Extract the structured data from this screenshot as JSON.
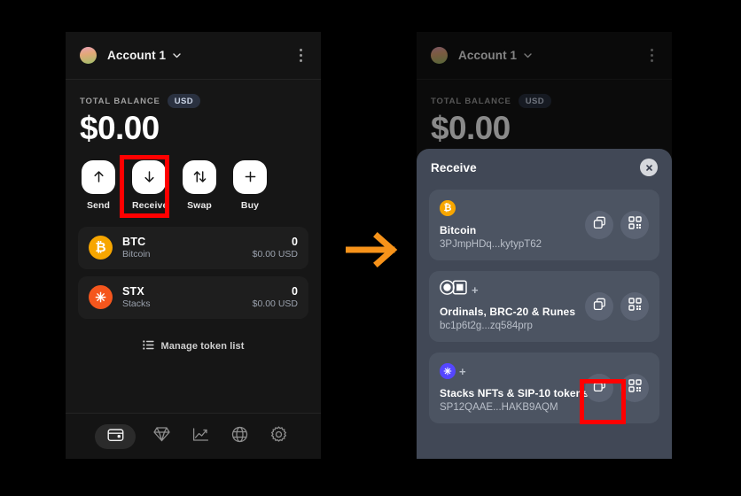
{
  "annotation": {
    "arrow_color": "#f7931a",
    "highlight_color": "#ff0000",
    "highlight_left_target": "Receive",
    "highlight_right_target": "copy-address-button"
  },
  "wallet": {
    "header": {
      "account_name": "Account 1",
      "avatar_icon": "account-avatar",
      "chevron_icon": "chevron-down-icon",
      "menu_icon": "kebab-menu-icon"
    },
    "balance": {
      "label": "TOTAL BALANCE",
      "currency_badge": "USD",
      "amount": "$0.00"
    },
    "actions": [
      {
        "label": "Send",
        "icon": "arrow-up-icon"
      },
      {
        "label": "Receive",
        "icon": "arrow-down-icon"
      },
      {
        "label": "Swap",
        "icon": "swap-arrows-icon"
      },
      {
        "label": "Buy",
        "icon": "plus-icon"
      }
    ],
    "tokens": [
      {
        "symbol": "BTC",
        "name": "Bitcoin",
        "amount": "0",
        "fiat": "$0.00 USD",
        "icon": "bitcoin-icon",
        "glyph": "₿",
        "color": "#f7a600"
      },
      {
        "symbol": "STX",
        "name": "Stacks",
        "amount": "0",
        "fiat": "$0.00 USD",
        "icon": "stacks-icon",
        "glyph": "✳",
        "color": "#f5561d"
      }
    ],
    "manage": {
      "label": "Manage token list",
      "icon": "list-icon"
    },
    "nav": [
      {
        "name": "wallet",
        "icon": "wallet-icon",
        "active": true
      },
      {
        "name": "nfts",
        "icon": "diamond-icon",
        "active": false
      },
      {
        "name": "activity",
        "icon": "chart-line-icon",
        "active": false
      },
      {
        "name": "explore",
        "icon": "globe-icon",
        "active": false
      },
      {
        "name": "settings",
        "icon": "gear-icon",
        "active": false
      }
    ]
  },
  "receive_modal": {
    "title": "Receive",
    "close_icon": "close-icon",
    "cards": [
      {
        "title": "Bitcoin",
        "address": "3PJmpHDq...kytypT62",
        "badge_icons": [
          "bitcoin-icon"
        ],
        "copy_icon": "copy-icon",
        "qr_icon": "qr-code-icon"
      },
      {
        "title": "Ordinals, BRC-20 & Runes",
        "address": "bc1p6t2g...zq584prp",
        "badge_icons": [
          "ordinals-icon",
          "plus-icon"
        ],
        "copy_icon": "copy-icon",
        "qr_icon": "qr-code-icon"
      },
      {
        "title": "Stacks NFTs & SIP-10 tokens",
        "address": "SP12QAAE...HAKB9AQM",
        "badge_icons": [
          "stacks-icon",
          "plus-icon"
        ],
        "copy_icon": "copy-icon",
        "qr_icon": "qr-code-icon"
      }
    ]
  }
}
